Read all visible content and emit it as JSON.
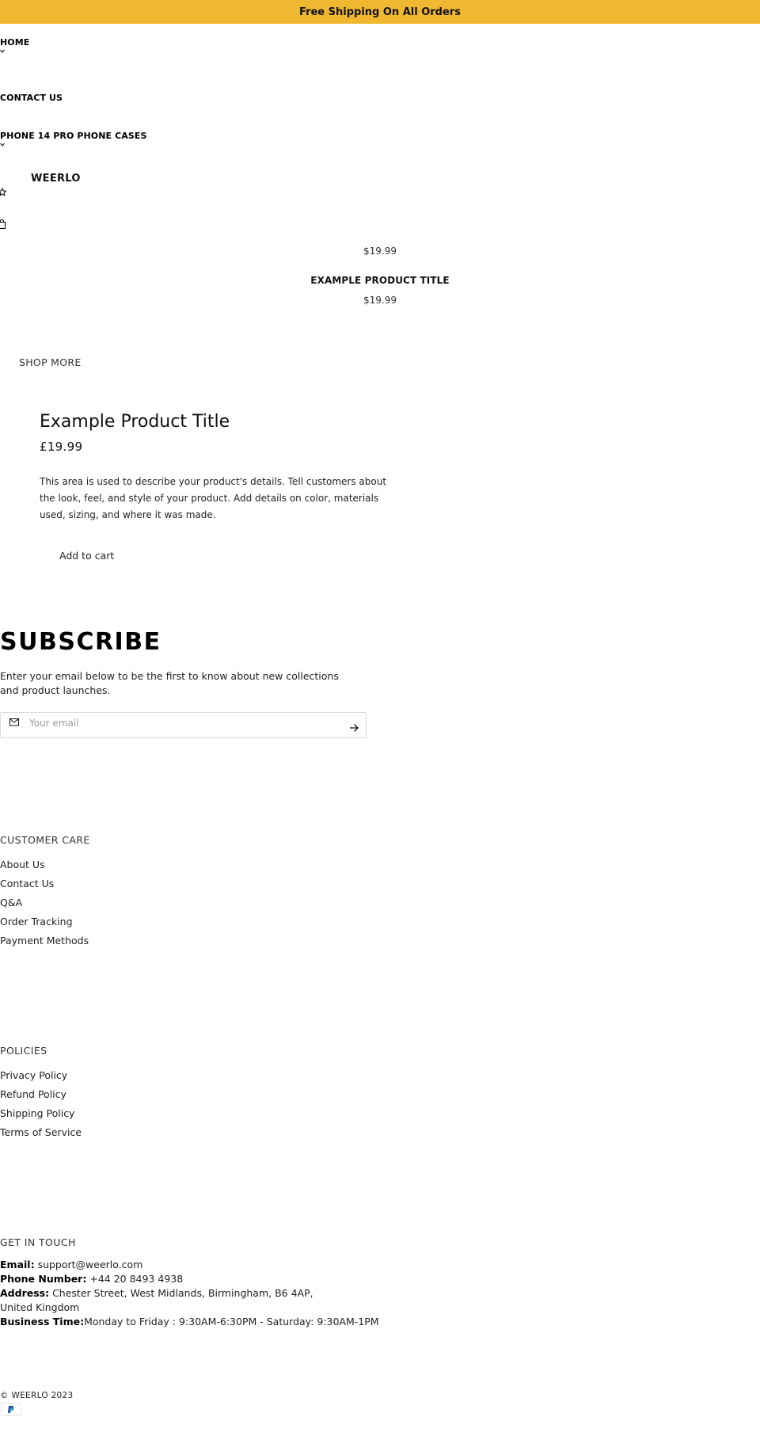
{
  "announcement": {
    "text": "Free Shipping On All Orders"
  },
  "nav": {
    "home": "HOME",
    "contact": "CONTACT US",
    "phone_cases": "PHONE 14 PRO PHONE CASES",
    "brand": "WEERLO",
    "dropdown_icon": "chevron-down-icon",
    "wishlist_icon": "star-icon",
    "cart_icon": "shopping-bag-icon"
  },
  "product_grid": {
    "items": [
      {
        "title": "",
        "price": "$19.99"
      },
      {
        "title": "EXAMPLE PRODUCT TITLE",
        "price": "$19.99"
      }
    ],
    "shop_more": "SHOP MORE"
  },
  "featured_product": {
    "title": "Example Product Title",
    "price": "£19.99",
    "description": "This area is used to describe your product's details. Tell customers about the look, feel, and style of your product. Add details on color, materials used, sizing, and where it was made.",
    "add_to_cart": "Add to cart"
  },
  "subscribe": {
    "title": "SUBSCRIBE",
    "description": "Enter your email below to be the first to know about new collections and product launches.",
    "placeholder": "Your email",
    "mail_icon": "mail-icon",
    "submit_icon": "arrow-right-icon"
  },
  "footer": {
    "customer_care": {
      "heading": "CUSTOMER CARE",
      "links": [
        "About Us",
        "Contact Us",
        "Q&A",
        "Order Tracking",
        "Payment Methods"
      ]
    },
    "policies": {
      "heading": "POLICIES",
      "links": [
        "Privacy Policy",
        "Refund Policy",
        "Shipping Policy",
        "Terms of Service"
      ]
    },
    "get_in_touch": {
      "heading": "GET IN TOUCH",
      "email_label": "Email:",
      "email": "support@weerlo.com",
      "phone_label": "Phone Number:",
      "phone": "+44 20 8493 4938",
      "address_label": "Address:",
      "address": "Chester Street, West Midlands, Birmingham, B6 4AP, United Kingdom",
      "hours_label": "Business Time:",
      "hours": "Monday to Friday : 9:30AM-6:30PM - Saturday: 9:30AM-1PM"
    },
    "copyright": "© WEERLO 2023",
    "payment_icon": "paypal-icon"
  },
  "colors": {
    "announcement_bg": "#f0b830",
    "text": "#111111",
    "border": "#dadada"
  }
}
